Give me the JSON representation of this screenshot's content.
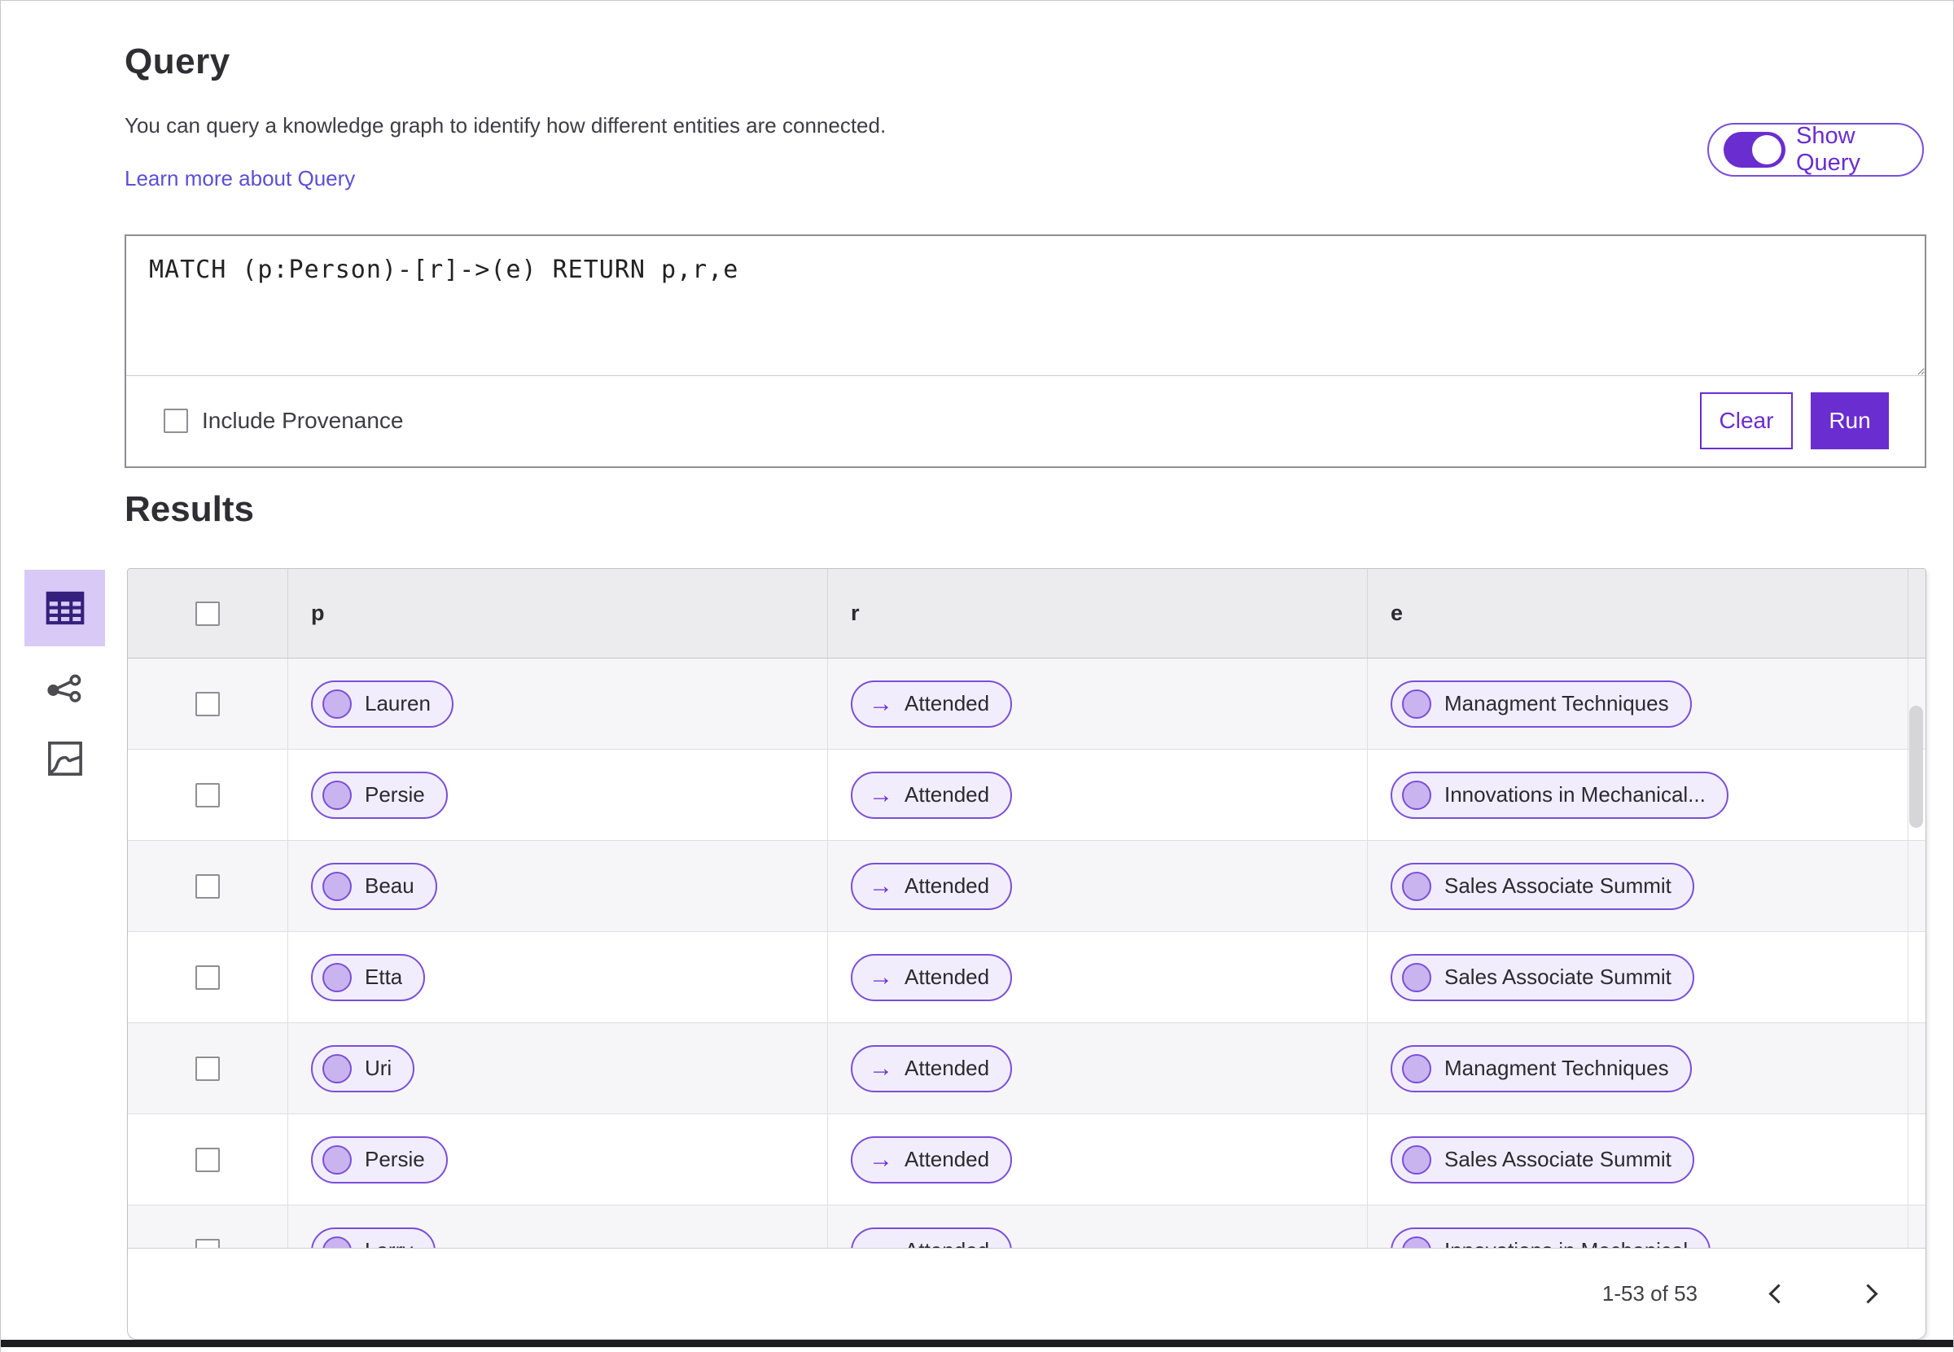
{
  "page": {
    "title": "Query",
    "description": "You can query a knowledge graph to identify how different entities are connected.",
    "learn_more": "Learn more about Query",
    "show_query_label": "Show Query",
    "show_query_on": true
  },
  "query_panel": {
    "query_text": "MATCH (p:Person)-[r]->(e) RETURN p,r,e",
    "include_provenance_label": "Include Provenance",
    "include_provenance_checked": false,
    "clear_label": "Clear",
    "run_label": "Run"
  },
  "results": {
    "title": "Results",
    "columns": [
      "p",
      "r",
      "e"
    ],
    "rows": [
      {
        "p": "Lauren",
        "r": "Attended",
        "e": "Managment Techniques"
      },
      {
        "p": "Persie",
        "r": "Attended",
        "e": "Innovations in Mechanical..."
      },
      {
        "p": "Beau",
        "r": "Attended",
        "e": "Sales Associate Summit"
      },
      {
        "p": "Etta",
        "r": "Attended",
        "e": "Sales Associate Summit"
      },
      {
        "p": "Uri",
        "r": "Attended",
        "e": "Managment Techniques"
      },
      {
        "p": "Persie",
        "r": "Attended",
        "e": "Sales Associate Summit"
      },
      {
        "p": "Larry",
        "r": "Attended",
        "e": "Innovations in Mechanical"
      }
    ],
    "pagination": {
      "range_text": "1-53 of 53",
      "prev_icon": "chevron-left-icon",
      "next_icon": "chevron-right-icon"
    }
  },
  "view_switcher": {
    "items": [
      {
        "icon": "table-view-icon",
        "selected": true
      },
      {
        "icon": "network-view-icon",
        "selected": false
      },
      {
        "icon": "map-view-icon",
        "selected": false
      }
    ]
  },
  "colors": {
    "accent_purple": "#6a2dd0",
    "pill_border": "#7a4fd8",
    "pill_background": "#f2edfc",
    "node_fill": "#c9b4ef",
    "selected_view_background": "#d9c9f6",
    "header_background": "#ececee",
    "row_stripe": "#f6f6f8",
    "link": "#5a4fd6"
  }
}
